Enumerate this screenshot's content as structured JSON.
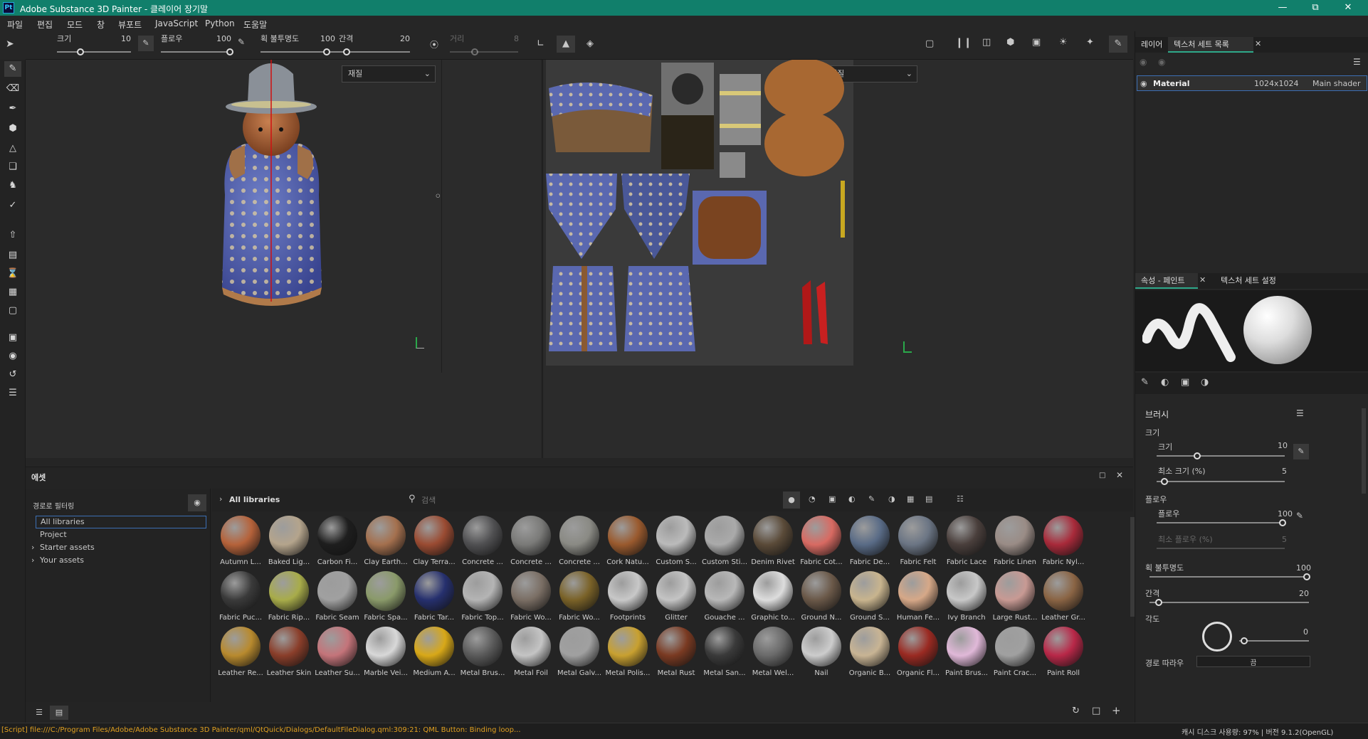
{
  "window": {
    "title": "Adobe Substance 3D Painter - 클레이어 장기말",
    "logo": "Pt"
  },
  "menu": [
    "파일",
    "편집",
    "모드",
    "창",
    "뷰포트",
    "JavaScript",
    "Python",
    "도움말"
  ],
  "toolbar": {
    "size_label": "크기",
    "size_value": "10",
    "flow_label": "플로우",
    "flow_value": "100",
    "opacity_label": "획 불투명도",
    "opacity_value": "100",
    "spacing_label": "간격",
    "spacing_value": "20",
    "distance_label": "거리",
    "distance_value": "8"
  },
  "viewport3d": {
    "material_dropdown": "재질"
  },
  "viewport2d": {
    "material_dropdown": "재질"
  },
  "layers_panel": {
    "tabs": [
      "레이어",
      "텍스처 세트 목록"
    ],
    "row": {
      "name": "Material",
      "size": "1024x1024",
      "shader": "Main shader"
    }
  },
  "properties_panel": {
    "tabs": [
      "속성 - 페인트",
      "텍스처 세트 설정"
    ],
    "section": "브러시",
    "size_group": "크기",
    "size_label": "크기",
    "size_value": "10",
    "min_size_label": "최소 크기 (%)",
    "min_size_value": "5",
    "flow_group": "플로우",
    "flow_label": "플로우",
    "flow_value": "100",
    "min_flow_label": "최소 플로우 (%)",
    "min_flow_value": "5",
    "opacity_label": "획 불투명도",
    "opacity_value": "100",
    "spacing_label": "간격",
    "spacing_value": "20",
    "angle_label": "각도",
    "angle_value": "0",
    "follow_path_label": "경로 따라우",
    "follow_path_value": "끔"
  },
  "assets_panel": {
    "title": "에셋",
    "filter_label": "경로로 필터링",
    "tree": [
      "All libraries",
      "Project",
      "Starter assets",
      "Your assets"
    ],
    "breadcrumb": "All libraries",
    "search_placeholder": "검색",
    "materials": [
      {
        "name": "Autumn L...",
        "color": "#b5623a"
      },
      {
        "name": "Baked Lig...",
        "color": "#b4a48c"
      },
      {
        "name": "Carbon Fi...",
        "color": "#1e1e1e"
      },
      {
        "name": "Clay Earth...",
        "color": "#a4704e"
      },
      {
        "name": "Clay Terra...",
        "color": "#9a4b32"
      },
      {
        "name": "Concrete ...",
        "color": "#505052"
      },
      {
        "name": "Concrete ...",
        "color": "#7a7a78"
      },
      {
        "name": "Concrete ...",
        "color": "#8a8a84"
      },
      {
        "name": "Cork Natu...",
        "color": "#9a5a2e"
      },
      {
        "name": "Custom S...",
        "color": "#bbbbbb"
      },
      {
        "name": "Custom Sti...",
        "color": "#aaaaaa"
      },
      {
        "name": "Denim Rivet",
        "color": "#5a4a38"
      },
      {
        "name": "Fabric Cot...",
        "color": "#d86a62"
      },
      {
        "name": "Fabric De...",
        "color": "#596b86"
      },
      {
        "name": "Fabric Felt",
        "color": "#6b7584"
      },
      {
        "name": "Fabric Lace",
        "color": "#4a3f3c"
      },
      {
        "name": "Fabric Linen",
        "color": "#9a8c86"
      },
      {
        "name": "Fabric Nyl...",
        "color": "#a82a3a"
      },
      {
        "name": "Fabric Puc...",
        "color": "#3a3a3a"
      },
      {
        "name": "Fabric Rip...",
        "color": "#a8ac4a"
      },
      {
        "name": "Fabric Seam",
        "color": "#a0a0a0"
      },
      {
        "name": "Fabric Spa...",
        "color": "#8a9a6a"
      },
      {
        "name": "Fabric Tar...",
        "color": "#26306e"
      },
      {
        "name": "Fabric Top...",
        "color": "#b4b4b4"
      },
      {
        "name": "Fabric Wo...",
        "color": "#7a6e64"
      },
      {
        "name": "Fabric Wo...",
        "color": "#7a6228"
      },
      {
        "name": "Footprints",
        "color": "#c8c8c8"
      },
      {
        "name": "Glitter",
        "color": "#c4c4c4"
      },
      {
        "name": "Gouache ...",
        "color": "#b8b8b8"
      },
      {
        "name": "Graphic to...",
        "color": "#dddddd"
      },
      {
        "name": "Ground N...",
        "color": "#6a5848"
      },
      {
        "name": "Ground S...",
        "color": "#c8b48e"
      },
      {
        "name": "Human Fe...",
        "color": "#d6a888"
      },
      {
        "name": "Ivy Branch",
        "color": "#c8c8c8"
      },
      {
        "name": "Large Rust...",
        "color": "#c89a94"
      },
      {
        "name": "Leather Gr...",
        "color": "#8a6444"
      },
      {
        "name": "Leather Re...",
        "color": "#b88a2e"
      },
      {
        "name": "Leather Skin",
        "color": "#8a3e2a"
      },
      {
        "name": "Leather Su...",
        "color": "#c4747a"
      },
      {
        "name": "Marble Vei...",
        "color": "#d8d8d8"
      },
      {
        "name": "Medium A...",
        "color": "#d8a818"
      },
      {
        "name": "Metal Brus...",
        "color": "#5a5a5a"
      },
      {
        "name": "Metal Foil",
        "color": "#c4c4c4"
      },
      {
        "name": "Metal Galv...",
        "color": "#a0a0a0"
      },
      {
        "name": "Metal Polis...",
        "color": "#c8a030"
      },
      {
        "name": "Metal Rust",
        "color": "#7a3a22"
      },
      {
        "name": "Metal San...",
        "color": "#3a3a3a"
      },
      {
        "name": "Metal Wel...",
        "color": "#6a6a6a"
      },
      {
        "name": "Nail",
        "color": "#cccccc"
      },
      {
        "name": "Organic B...",
        "color": "#c8b494"
      },
      {
        "name": "Organic Fl...",
        "color": "#9a2a22"
      },
      {
        "name": "Paint Brus...",
        "color": "#e0b8d8"
      },
      {
        "name": "Paint Crac...",
        "color": "#a0a0a0"
      },
      {
        "name": "Paint Roll",
        "color": "#b82848"
      }
    ]
  },
  "status": {
    "script": "[Script] file:///C:/Program Files/Adobe/Adobe Substance 3D Painter/qml/QtQuick/Dialogs/DefaultFileDialog.qml:309:21: QML Button: Binding loop...",
    "right": "캐시 디스크 사용량:  97% | 버전 9.1.2(OpenGL)"
  },
  "icons": [
    "pointer-icon",
    "brush-icon",
    "eraser-icon",
    "projection-icon",
    "geometry-fill-icon",
    "smudge-icon",
    "clone-icon",
    "picker-icon",
    "polygon-fill-icon",
    "export-icon",
    "camera-icon",
    "history-icon",
    "settings-icon",
    "eye-icon",
    "close-icon",
    "hamburger-icon",
    "search-icon"
  ]
}
